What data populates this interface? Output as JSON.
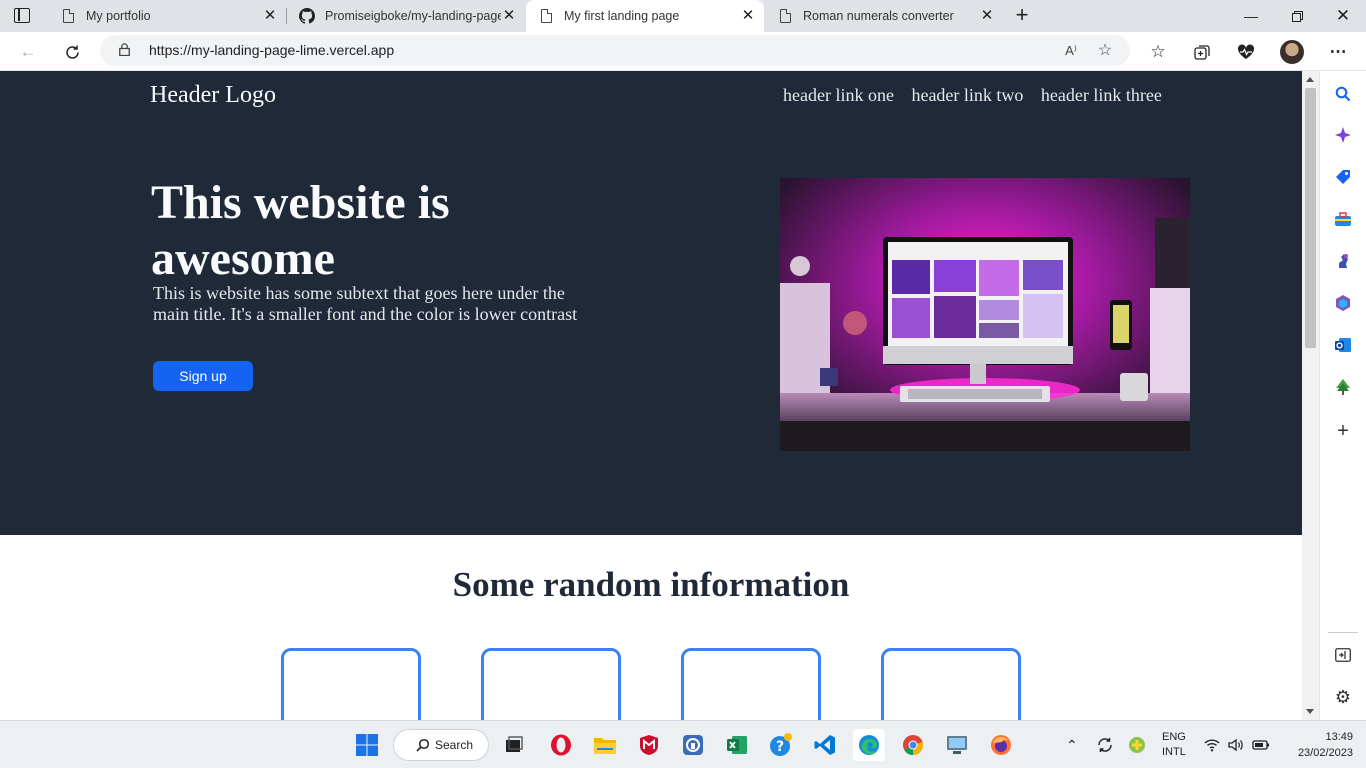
{
  "browser": {
    "tabs": [
      {
        "title": "My portfolio",
        "active": false
      },
      {
        "title": "Promiseigboke/my-landing-page",
        "active": false
      },
      {
        "title": "My first landing page",
        "active": true
      },
      {
        "title": "Roman numerals converter",
        "active": false
      }
    ],
    "url_scheme": "https://",
    "url_host": "my-landing-page-lime.vercel.app",
    "read_aloud_label": "A⁾"
  },
  "page": {
    "logo": "Header Logo",
    "nav": [
      "header link one",
      "header link two",
      "header link three"
    ],
    "hero_title": "This website is awesome",
    "hero_subtext": "This is website has some subtext that goes here under the main title. It's a smaller font and the color is lower contrast",
    "signup_label": "Sign up",
    "info_title": "Some random information"
  },
  "taskbar": {
    "search_label": "Search",
    "lang_line1": "ENG",
    "lang_line2": "INTL",
    "time": "13:49",
    "date": "23/02/2023"
  },
  "colors": {
    "hero_bg": "#1f2937",
    "button": "#1463f3",
    "card_border": "#3b82f6"
  }
}
